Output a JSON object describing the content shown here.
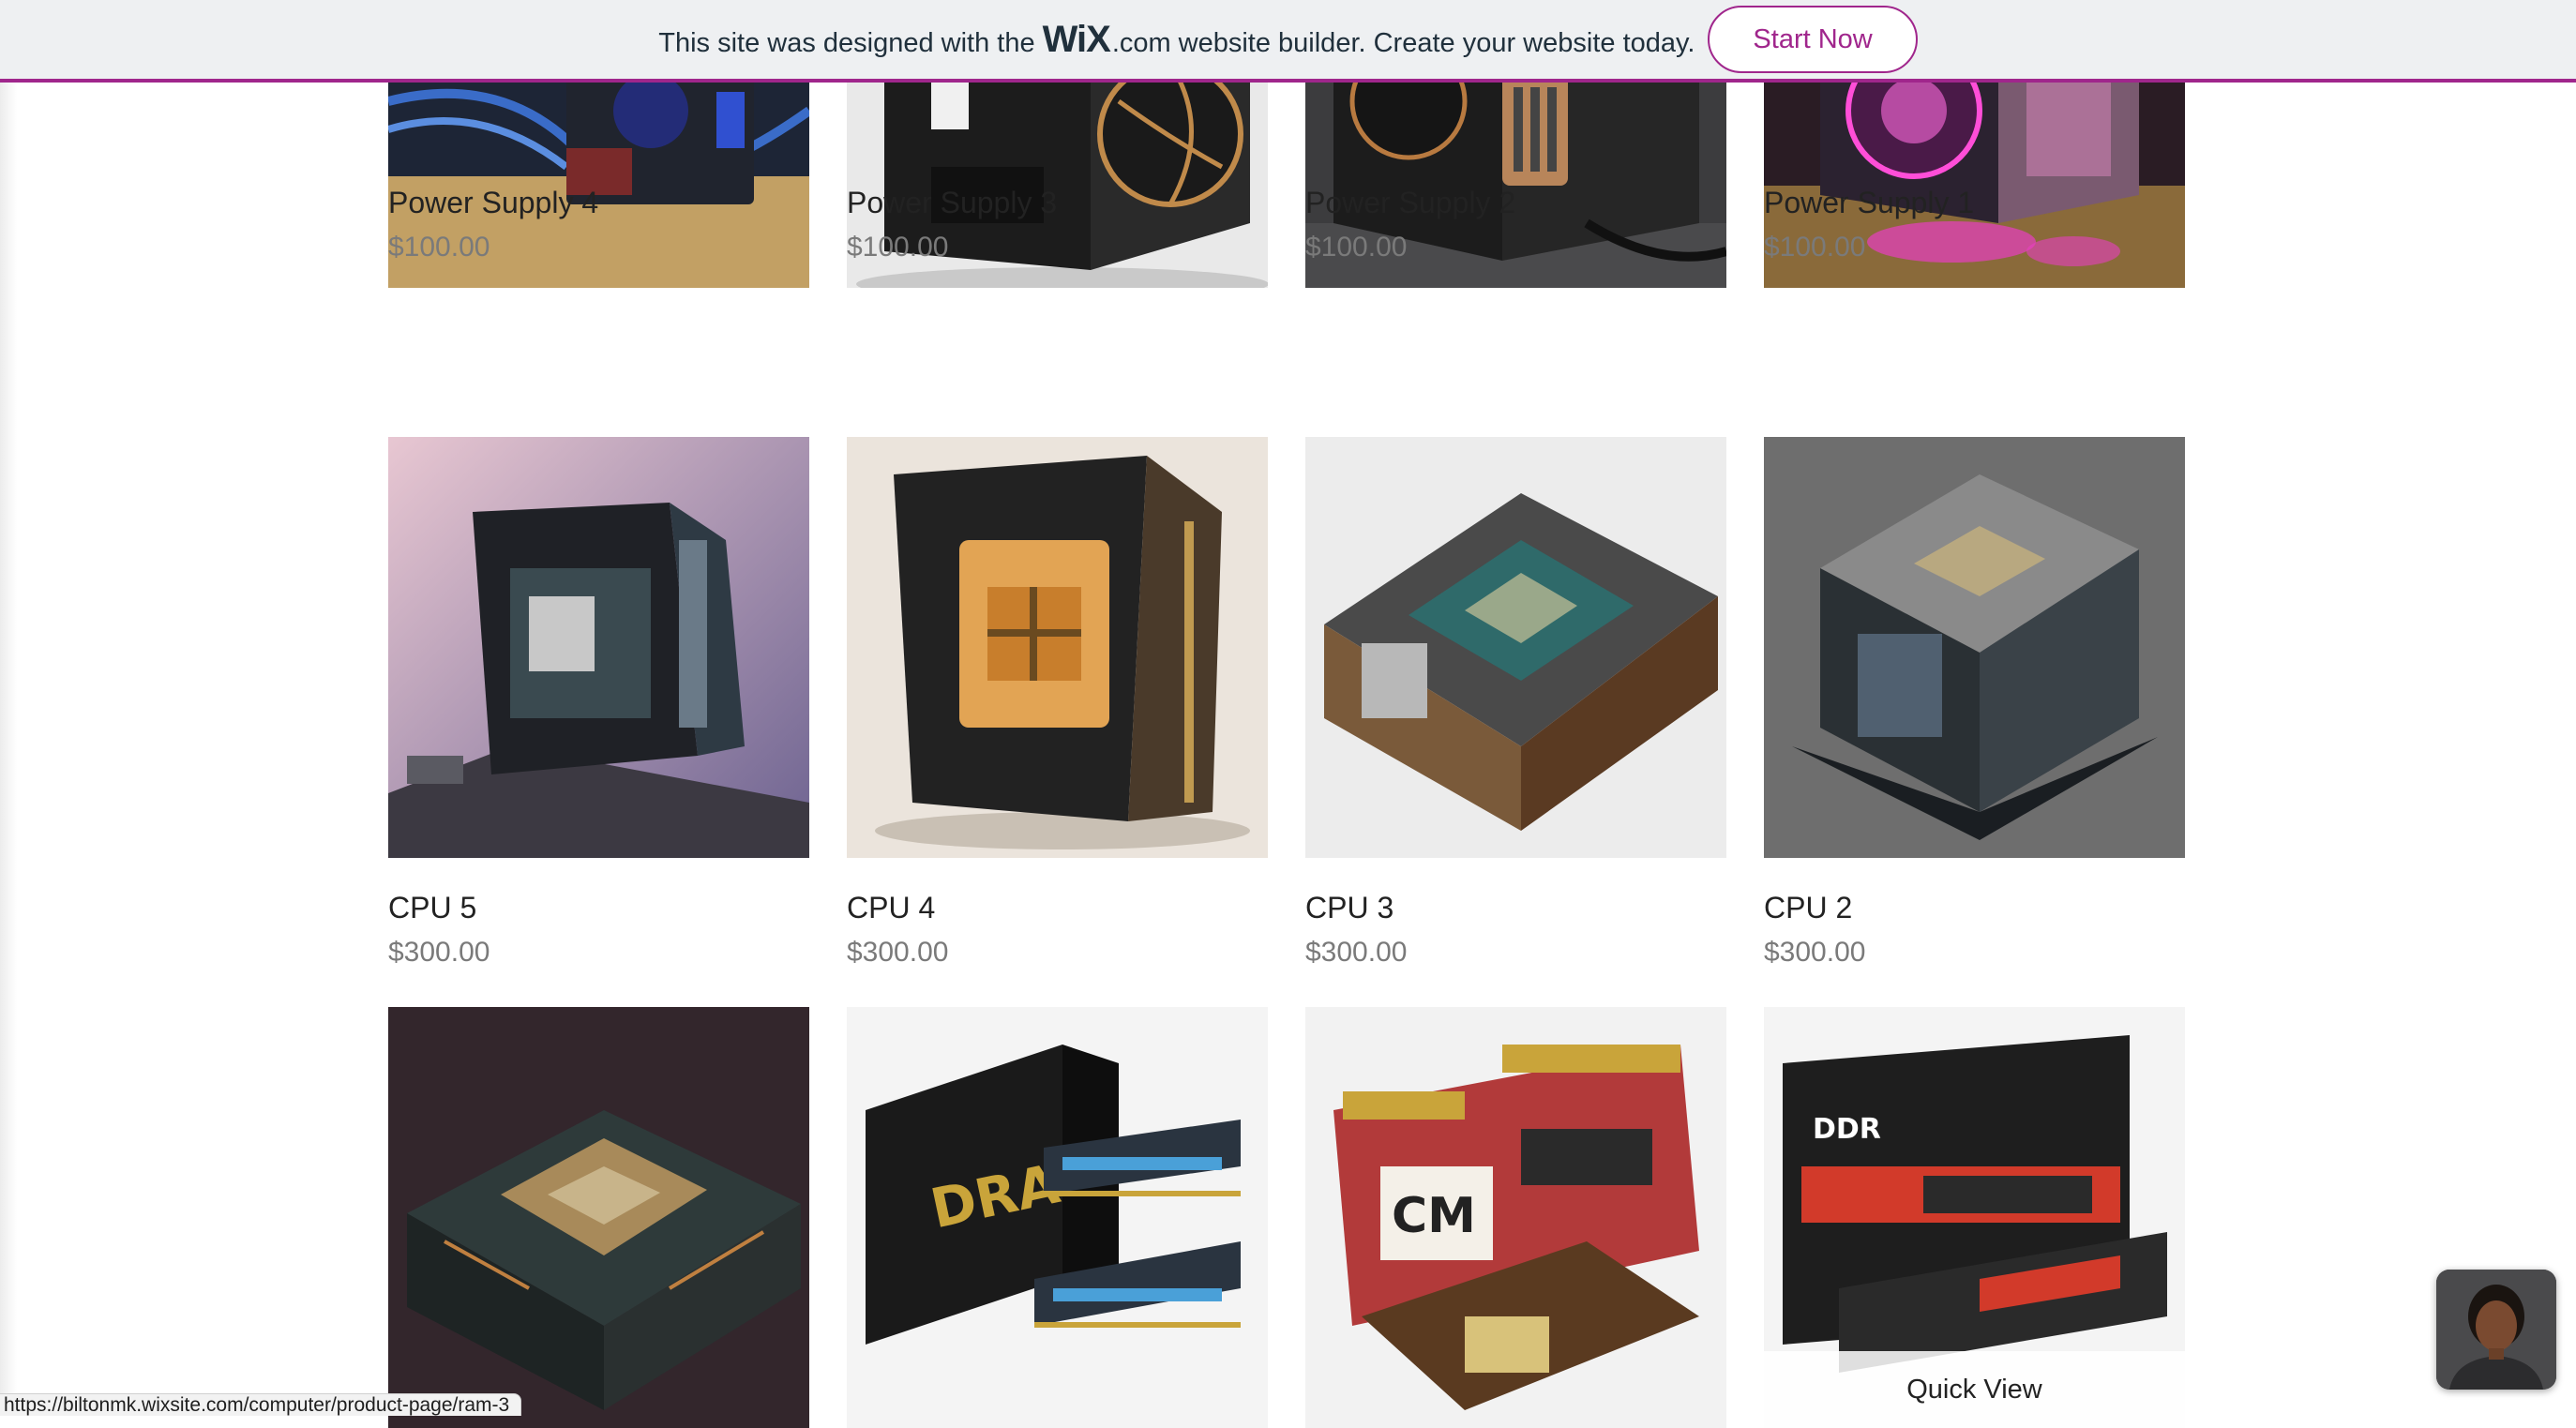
{
  "banner": {
    "text_before": "This site was designed with the",
    "wix_logo": "WiX",
    "dotcom": ".com",
    "text_after": "website builder. Create your website today.",
    "button_label": "Start Now",
    "accent_color": "#a0268c"
  },
  "products": {
    "row1": [
      {
        "name": "Power Supply 4",
        "price": "$100.00",
        "image_icon": "power-supply-icon"
      },
      {
        "name": "Power Supply 3",
        "price": "$100.00",
        "image_icon": "power-supply-icon"
      },
      {
        "name": "Power Supply 2",
        "price": "$100.00",
        "image_icon": "power-supply-icon"
      },
      {
        "name": "Power Supply 1",
        "price": "$100.00",
        "image_icon": "power-supply-icon"
      }
    ],
    "row2": [
      {
        "name": "CPU 5",
        "price": "$300.00",
        "image_icon": "cpu-icon"
      },
      {
        "name": "CPU 4",
        "price": "$300.00",
        "image_icon": "cpu-icon"
      },
      {
        "name": "CPU 3",
        "price": "$300.00",
        "image_icon": "cpu-icon"
      },
      {
        "name": "CPU 2",
        "price": "$300.00",
        "image_icon": "cpu-icon"
      }
    ],
    "row3": [
      {
        "image_icon": "cpu-icon"
      },
      {
        "image_icon": "ram-icon"
      },
      {
        "image_icon": "ram-icon"
      },
      {
        "image_icon": "ram-icon"
      }
    ],
    "quick_view_label": "Quick View"
  },
  "status_bar": {
    "url": "https://biltonmk.wixsite.com/computer/product-page/ram-3"
  },
  "chat": {
    "avatar_icon": "agent-avatar-icon"
  }
}
